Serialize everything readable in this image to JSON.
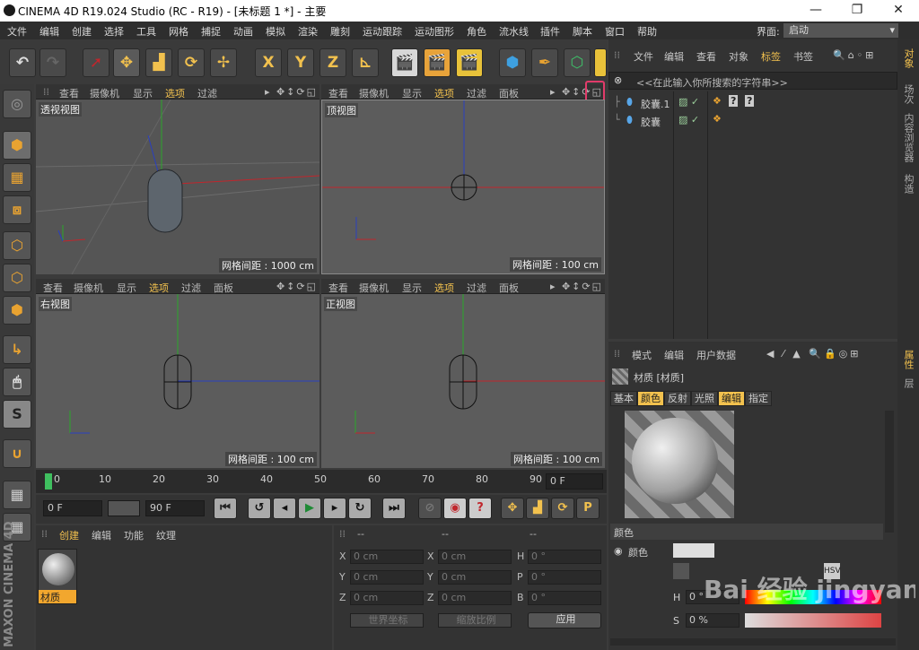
{
  "titlebar": {
    "title": "CINEMA 4D R19.024 Studio (RC - R19) - [未标题 1 *] - 主要",
    "min": "—",
    "max": "❐",
    "close": "✕"
  },
  "menu": [
    "文件",
    "编辑",
    "创建",
    "选择",
    "工具",
    "网格",
    "捕捉",
    "动画",
    "模拟",
    "渲染",
    "雕刻",
    "运动跟踪",
    "运动图形",
    "角色",
    "流水线",
    "插件",
    "脚本",
    "窗口",
    "帮助"
  ],
  "interface": {
    "label": "界面:",
    "value": "启动"
  },
  "viewport_menu": [
    "查看",
    "摄像机",
    "显示",
    "选项",
    "过滤",
    "面板"
  ],
  "viewports": [
    {
      "label": "透视视图",
      "grid": "网格间距 : 1000 cm"
    },
    {
      "label": "顶视图",
      "grid": "网格间距 : 100 cm"
    },
    {
      "label": "右视图",
      "grid": "网格间距 : 100 cm"
    },
    {
      "label": "正视图",
      "grid": "网格间距 : 100 cm"
    }
  ],
  "axis": {
    "x": "X",
    "y": "Y",
    "z": "Z"
  },
  "colors": {
    "accent": "#f2c14e",
    "highlight_box": "#e23b6a",
    "x_axis": "#c0262c",
    "y_axis": "#2aa82a",
    "z_axis": "#2a3fc0"
  },
  "timeline": {
    "ticks": [
      "0",
      "10",
      "20",
      "30",
      "40",
      "50",
      "60",
      "70",
      "80",
      "90"
    ],
    "current_frame": "0 F"
  },
  "transport": {
    "start": "0 F",
    "end": "90 F"
  },
  "material_manager": {
    "menu": [
      "创建",
      "编辑",
      "功能",
      "纹理"
    ],
    "material_name": "材质"
  },
  "coords": {
    "header": [
      "--",
      "--",
      "--"
    ],
    "rows": [
      {
        "a": "X",
        "av": "0 cm",
        "b": "X",
        "bv": "0 cm",
        "c": "H",
        "cv": "0 °"
      },
      {
        "a": "Y",
        "av": "0 cm",
        "b": "Y",
        "bv": "0 cm",
        "c": "P",
        "cv": "0 °"
      },
      {
        "a": "Z",
        "av": "0 cm",
        "b": "Z",
        "bv": "0 cm",
        "c": "B",
        "cv": "0 °"
      }
    ],
    "world": "世界坐标",
    "scale": "缩放比例",
    "apply": "应用"
  },
  "object_manager": {
    "menu": [
      "文件",
      "编辑",
      "查看",
      "对象",
      "标签",
      "书签"
    ],
    "search_placeholder": "<<在此输入你所搜索的字符串>>",
    "objects": [
      "胶囊.1",
      "胶囊"
    ]
  },
  "attribute_manager": {
    "menu": [
      "模式",
      "编辑",
      "用户数据"
    ],
    "title": "材质 [材质]",
    "tabs": [
      "基本",
      "颜色",
      "反射",
      "光照",
      "编辑",
      "指定"
    ],
    "section": "颜色",
    "color_label": "颜色",
    "hsv": "HSV",
    "h_label": "H",
    "h_value": "0 °",
    "s_label": "S",
    "s_value": "0 %"
  },
  "right_tabs": [
    "对象",
    "场次",
    "内容浏览器",
    "构造"
  ],
  "right_tabs2": [
    "属性",
    "层"
  ],
  "brand": "MAXON CINEMA 4D",
  "watermark": "Bai 经验 jingyan.baidu.com"
}
